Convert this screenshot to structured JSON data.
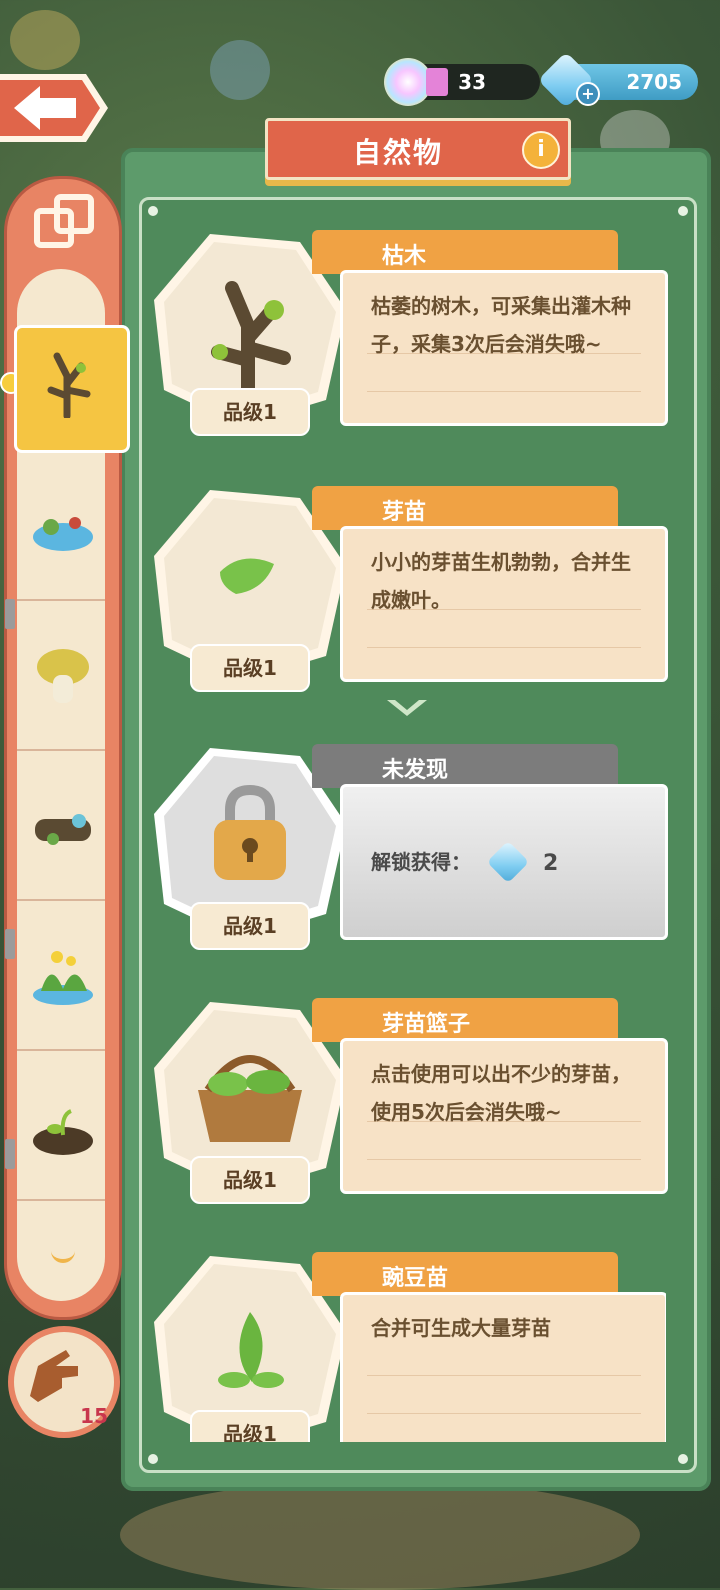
{
  "header": {
    "rainbow_count": "33",
    "gem_count": "2705",
    "title": "自然物"
  },
  "cards": [
    {
      "name": "枯木",
      "desc": "枯萎的树木，可采集出灌木种子，采集3次后会消失哦~",
      "grade": "品级1",
      "icon": "dead-tree-icon",
      "locked": false
    },
    {
      "name": "芽苗",
      "desc": "小小的芽苗生机勃勃，合并生成嫩叶。",
      "grade": "品级1",
      "icon": "sprout-icon",
      "locked": false
    },
    {
      "name": "未发现",
      "desc": "解锁获得：",
      "reward": "2",
      "grade": "品级1",
      "icon": "padlock-icon",
      "locked": true
    },
    {
      "name": "芽苗篮子",
      "desc": "点击使用可以出不少的芽苗，使用5次后会消失哦~",
      "grade": "品级1",
      "icon": "sprout-basket-icon",
      "locked": false
    },
    {
      "name": "豌豆苗",
      "desc": "合并可生成大量芽苗",
      "grade": "品级1",
      "icon": "pea-sprout-icon",
      "locked": false
    }
  ],
  "sidebar": {
    "items": [
      {
        "icon": "dead-tree-icon",
        "selected": true
      },
      {
        "icon": "pond-icon"
      },
      {
        "icon": "mushroom-icon"
      },
      {
        "icon": "mossy-log-icon"
      },
      {
        "icon": "flower-patch-icon"
      },
      {
        "icon": "seedling-mound-icon"
      }
    ],
    "finger_count": "15"
  },
  "colors": {
    "panel_green": "#5d9b6b",
    "title_red": "#e0654a",
    "name_tab_orange": "#f0a244",
    "card_cream": "#f7e2c6"
  }
}
